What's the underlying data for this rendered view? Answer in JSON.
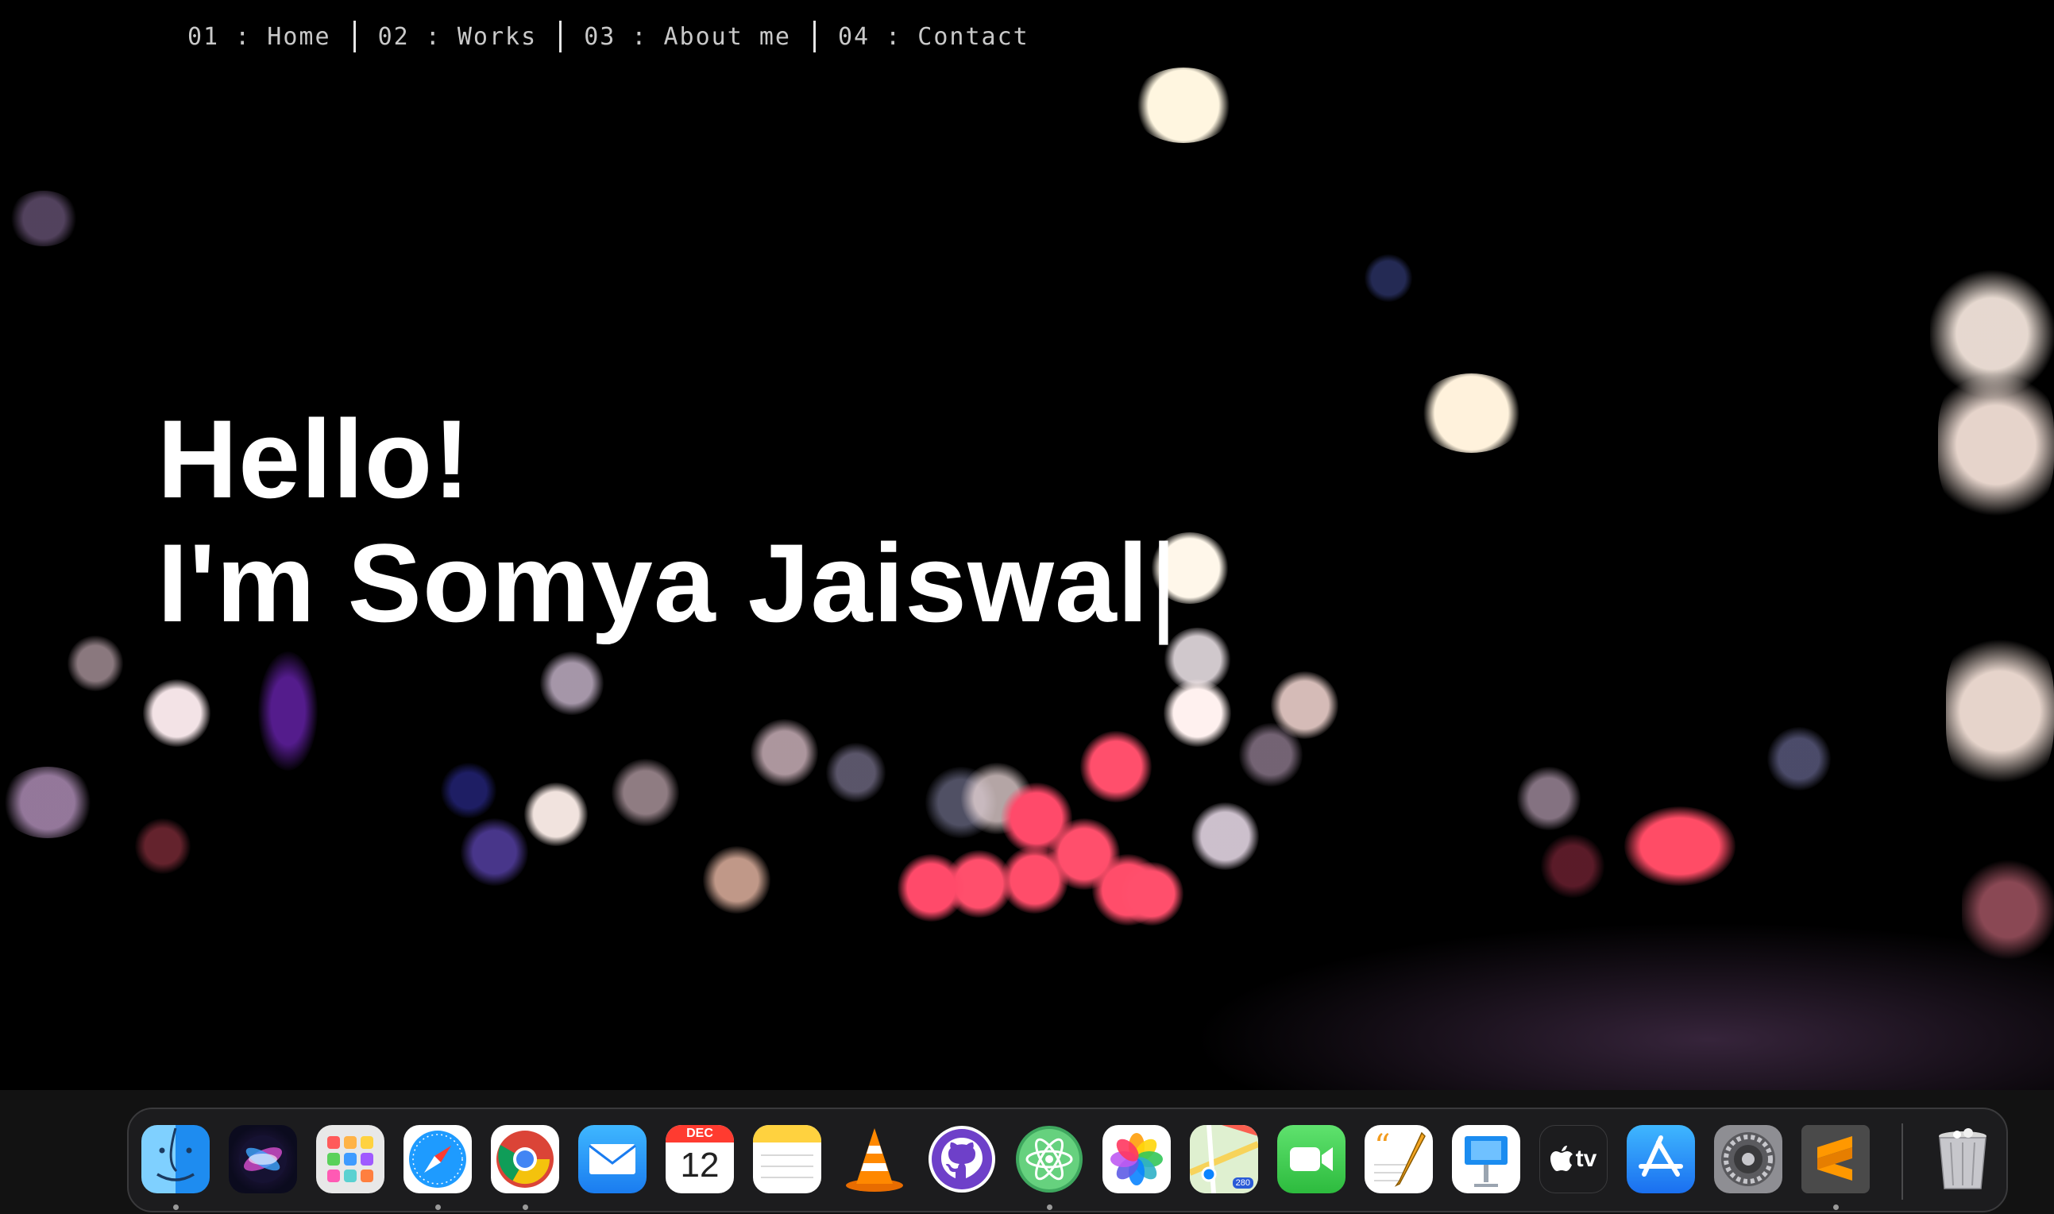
{
  "nav": {
    "items": [
      {
        "label": "01 : Home"
      },
      {
        "label": "02 : Works"
      },
      {
        "label": "03 : About me"
      },
      {
        "label": "04 : Contact"
      }
    ]
  },
  "hero": {
    "greeting": "Hello!",
    "intro": "I'm Somya Jaiswal",
    "caret": "|"
  },
  "dock": {
    "apps": [
      {
        "icon": "finder-icon",
        "running": true
      },
      {
        "icon": "siri-icon",
        "running": false
      },
      {
        "icon": "launchpad-icon",
        "running": false
      },
      {
        "icon": "safari-icon",
        "running": true
      },
      {
        "icon": "chrome-icon",
        "running": true
      },
      {
        "icon": "mail-icon",
        "running": false
      },
      {
        "icon": "calendar-icon",
        "running": false,
        "month": "DEC",
        "day": "12"
      },
      {
        "icon": "notes-icon",
        "running": false
      },
      {
        "icon": "vlc-icon",
        "running": false
      },
      {
        "icon": "github-icon",
        "running": false
      },
      {
        "icon": "atom-icon",
        "running": true
      },
      {
        "icon": "photos-icon",
        "running": false
      },
      {
        "icon": "maps-icon",
        "running": false,
        "badge": "280"
      },
      {
        "icon": "facetime-icon",
        "running": false
      },
      {
        "icon": "pages-icon",
        "running": false
      },
      {
        "icon": "keynote-icon",
        "running": false
      },
      {
        "icon": "apple-tv-icon",
        "running": false,
        "label": "tv"
      },
      {
        "icon": "app-store-icon",
        "running": false
      },
      {
        "icon": "system-preferences-icon",
        "running": false
      },
      {
        "icon": "sublime-text-icon",
        "running": true
      },
      {
        "icon": "trash-icon",
        "running": false
      }
    ]
  },
  "colors": {
    "background": "#000000",
    "heading": "#ffffff",
    "nav_text": "#c9c9c9",
    "dock_bg": "#1c1c1e"
  }
}
